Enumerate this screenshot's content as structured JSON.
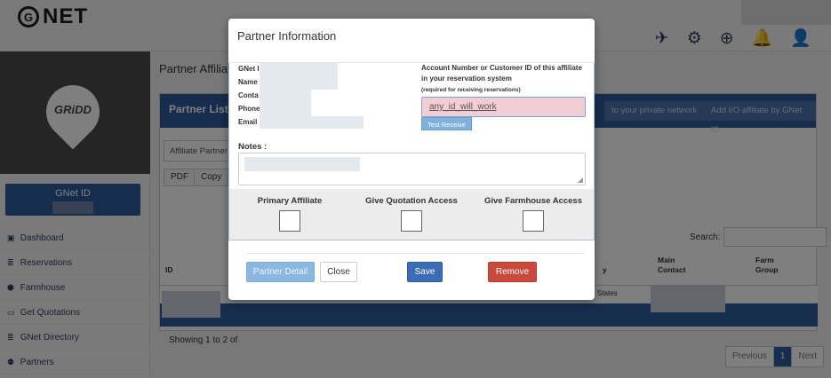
{
  "app": {
    "logo_mark": "G",
    "logo_text": "NET"
  },
  "topbar": {
    "icons": [
      {
        "name": "airline-ticket-icon",
        "glyph": "✈"
      },
      {
        "name": "gear-icon",
        "glyph": "⚙"
      },
      {
        "name": "lifebuoy-icon",
        "glyph": "⊕"
      },
      {
        "name": "bell-icon",
        "glyph": "🔔"
      },
      {
        "name": "user-icon",
        "glyph": "👤"
      }
    ]
  },
  "sidebar": {
    "brand": "GRiDD",
    "gnet_id_label": "GNet ID",
    "items": [
      {
        "icon": "▣",
        "label": "Dashboard"
      },
      {
        "icon": "≣",
        "label": "Reservations"
      },
      {
        "icon": "⬢",
        "label": "Farmhouse"
      },
      {
        "icon": "▭",
        "label": "Get Quotations"
      },
      {
        "icon": "≣",
        "label": "GNet Directory"
      },
      {
        "icon": "⚉",
        "label": "Partners"
      }
    ]
  },
  "content": {
    "title": "Partner Affiliati",
    "panel_title": "Partner Listing",
    "btn_private": "to your private network",
    "btn_add_io": "Add I/O affiliate by GNet ID",
    "tab_label": "Affiliate Partner",
    "btn_pdf": "PDF",
    "btn_copy": "Copy",
    "search_label": "Search:",
    "col_id": "ID",
    "col_y": "y",
    "col_main_contact": "Main\nContact",
    "col_farm_group": "Farm\nGroup",
    "row_states": "States",
    "showing": "Showing 1 to 2 of",
    "pager": {
      "prev": "Previous",
      "page": "1",
      "next": "Next"
    }
  },
  "modal": {
    "title": "Partner Information",
    "labels": {
      "gnet": "GNet I",
      "name": "Name",
      "contact": "Conta",
      "phone": "Phone",
      "email": "Email"
    },
    "account_label": "Account Number or Customer ID of this affiliate in your reservation system",
    "account_sub": "(required for receiving reservations)",
    "account_value": "any_id_will_work",
    "test_receive": "Test Receive",
    "notes_label": "Notes :",
    "options": [
      {
        "label": "Primary Affiliate"
      },
      {
        "label": "Give Quotation Access"
      },
      {
        "label": "Give Farmhouse Access"
      }
    ],
    "buttons": {
      "partner_detail": "Partner Detail",
      "close": "Close",
      "save": "Save",
      "remove": "Remove"
    }
  },
  "colors": {
    "primary": "#2f5b9a",
    "danger": "#c9493d",
    "highlight_input": "#f2cdd3"
  }
}
